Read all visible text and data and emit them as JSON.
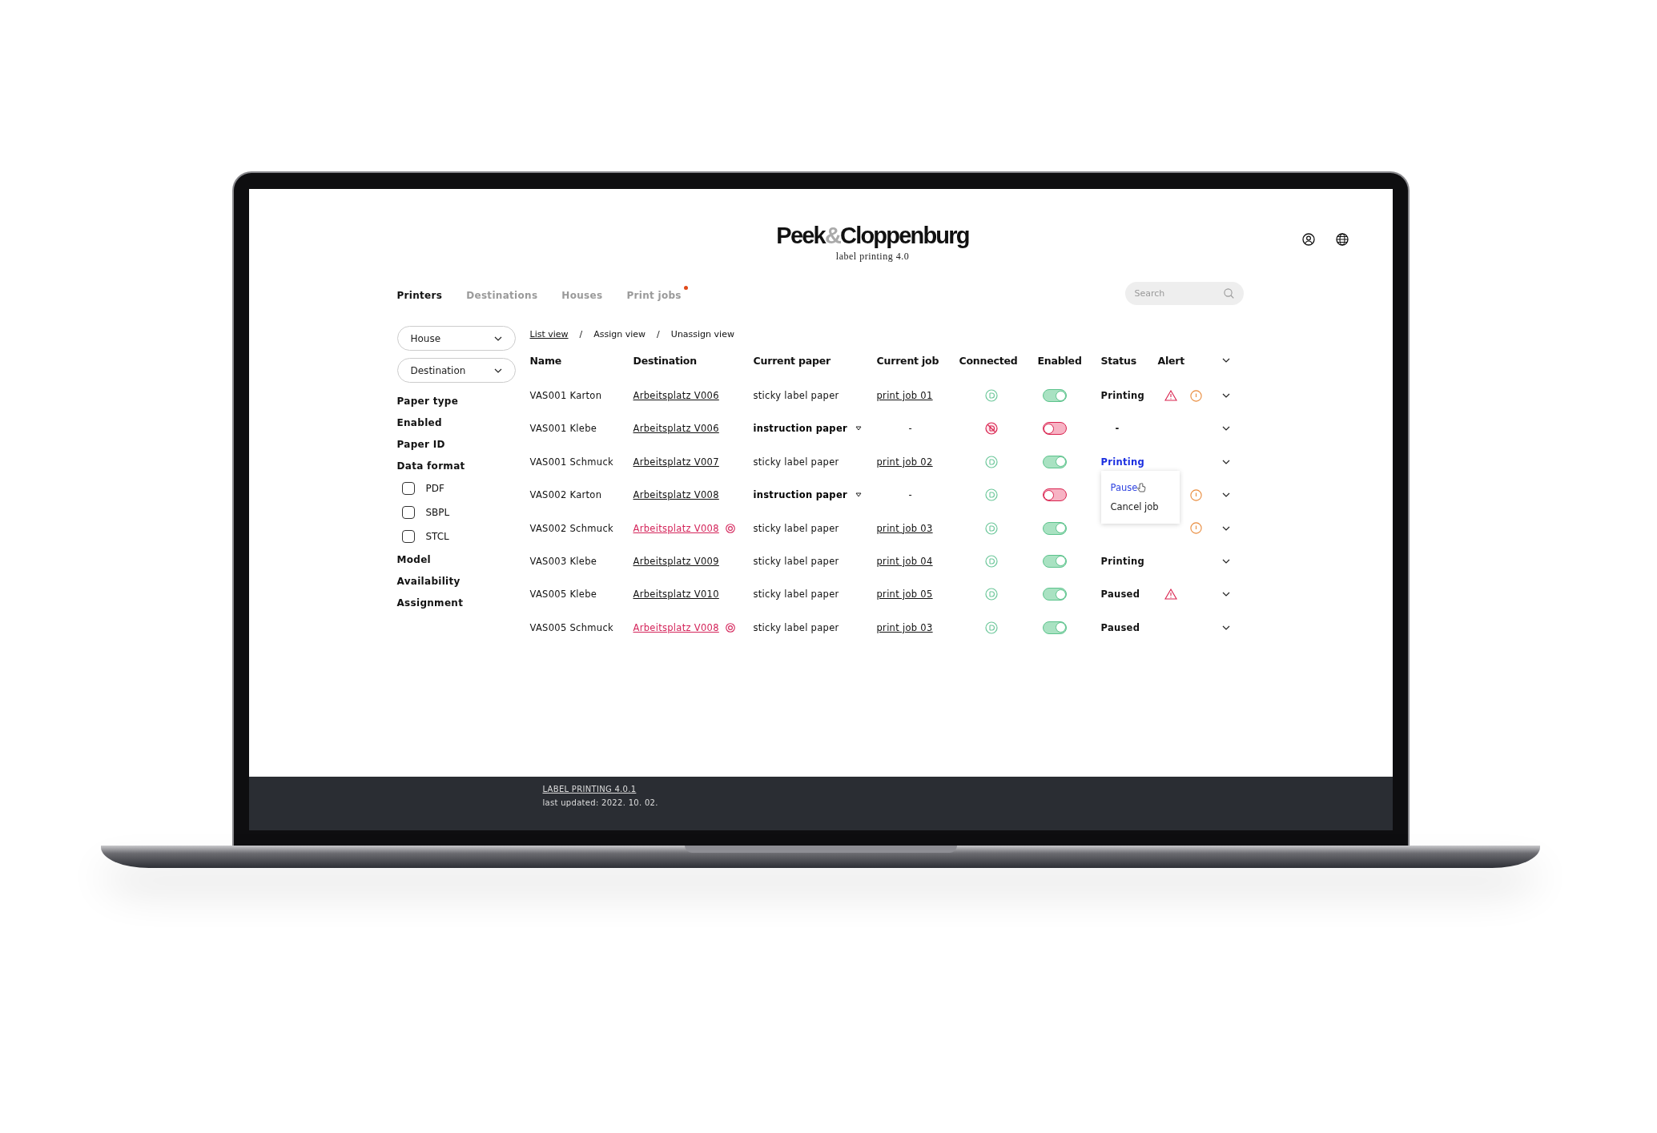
{
  "logo": {
    "parts": [
      {
        "text": "Peek",
        "muted": false
      },
      {
        "text": "&",
        "muted": true
      },
      {
        "text": "Cloppenburg",
        "muted": false
      }
    ],
    "subtitle": "label printing 4.0"
  },
  "tabs": [
    {
      "label": "Printers",
      "selected": true,
      "badge": false
    },
    {
      "label": "Destinations",
      "selected": false,
      "badge": false
    },
    {
      "label": "Houses",
      "selected": false,
      "badge": false
    },
    {
      "label": "Print jobs",
      "selected": false,
      "badge": true
    }
  ],
  "search": {
    "placeholder": "Search"
  },
  "filters": [
    {
      "kind": "dropdown",
      "label": "House"
    },
    {
      "kind": "dropdown",
      "label": "Destination"
    },
    {
      "kind": "heading",
      "label": "Paper type"
    },
    {
      "kind": "heading",
      "label": "Enabled"
    },
    {
      "kind": "heading",
      "label": "Paper ID"
    },
    {
      "kind": "heading",
      "label": "Data format"
    },
    {
      "kind": "checkbox",
      "label": "PDF",
      "checked": false
    },
    {
      "kind": "checkbox",
      "label": "SBPL",
      "checked": false
    },
    {
      "kind": "checkbox",
      "label": "STCL",
      "checked": false
    },
    {
      "kind": "heading",
      "label": "Model"
    },
    {
      "kind": "heading",
      "label": "Availability"
    },
    {
      "kind": "heading",
      "label": "Assignment"
    }
  ],
  "breadcrumb": [
    {
      "label": "List view",
      "selected": true
    },
    {
      "label": "Assign view",
      "selected": false
    },
    {
      "label": "Unassign view",
      "selected": false
    }
  ],
  "breadcrumb_separator": "/",
  "table": {
    "columns": [
      "Name",
      "Destination",
      "Current paper",
      "Current job",
      "Connected",
      "Enabled",
      "Status",
      "Alert"
    ],
    "rows": [
      {
        "name": "VAS001 Karton",
        "destination": "Arbeitsplatz V006",
        "destination_alert": false,
        "paper": "sticky label paper",
        "paper_dropdown": false,
        "job": "print job 01",
        "connected": true,
        "enabled": true,
        "status": {
          "text": "Printing",
          "selected": false
        },
        "alerts": [
          {
            "kind": "warning"
          },
          {
            "kind": "info"
          }
        ]
      },
      {
        "name": "VAS001 Klebe",
        "destination": "Arbeitsplatz V006",
        "destination_alert": false,
        "paper": "instruction paper",
        "paper_dropdown": true,
        "job": "-",
        "connected": false,
        "enabled": false,
        "status": {
          "text": "-",
          "selected": false
        }
      },
      {
        "name": "VAS001 Schmuck",
        "destination": "Arbeitsplatz V007",
        "destination_alert": false,
        "paper": "sticky label paper",
        "paper_dropdown": false,
        "job": "print job 02",
        "connected": true,
        "enabled": true,
        "status": {
          "text": "Printing",
          "selected": true
        },
        "menu": [
          {
            "label": "Pause",
            "selected": true
          },
          {
            "label": "Cancel job",
            "selected": false
          }
        ]
      },
      {
        "name": "VAS002 Karton",
        "destination": "Arbeitsplatz V008",
        "destination_alert": false,
        "paper": "instruction paper",
        "paper_dropdown": true,
        "job": "-",
        "connected": true,
        "enabled": false,
        "alerts": [
          {
            "kind": "info"
          }
        ]
      },
      {
        "name": "VAS002 Schmuck",
        "destination": "Arbeitsplatz V008",
        "destination_alert": true,
        "paper": "sticky label paper",
        "paper_dropdown": false,
        "job": "print job 03",
        "connected": true,
        "enabled": true,
        "alerts": [
          {
            "kind": "info"
          }
        ]
      },
      {
        "name": "VAS003 Klebe",
        "destination": "Arbeitsplatz V009",
        "destination_alert": false,
        "paper": "sticky label paper",
        "paper_dropdown": false,
        "job": "print job 04",
        "connected": true,
        "enabled": true,
        "status": {
          "text": "Printing",
          "selected": false
        }
      },
      {
        "name": "VAS005 Klebe",
        "destination": "Arbeitsplatz V010",
        "destination_alert": false,
        "paper": "sticky label paper",
        "paper_dropdown": false,
        "job": "print job 05",
        "connected": true,
        "enabled": true,
        "status": {
          "text": "Paused",
          "selected": false
        },
        "alerts": [
          {
            "kind": "warning"
          }
        ]
      },
      {
        "name": "VAS005 Schmuck",
        "destination": "Arbeitsplatz V008",
        "destination_alert": true,
        "paper": "sticky label paper",
        "paper_dropdown": false,
        "job": "print job 03",
        "connected": true,
        "enabled": true,
        "status": {
          "text": "Paused",
          "selected": false
        }
      }
    ]
  },
  "footer": {
    "link": "LABEL PRINTING 4.0.1",
    "updated": "last updated: 2022. 10. 02."
  }
}
